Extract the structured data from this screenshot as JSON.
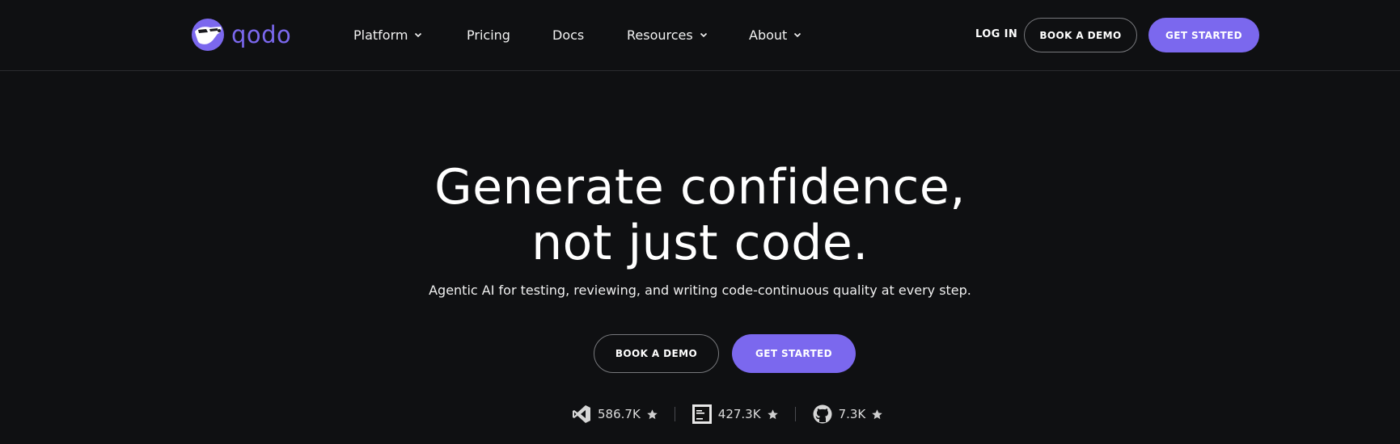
{
  "brand": {
    "name": "qodo",
    "logo_icon": "qodo-mascot-icon",
    "accent_color": "#7b68ee",
    "background_color": "#0f1012"
  },
  "nav": {
    "items": [
      {
        "label": "Platform",
        "has_dropdown": true
      },
      {
        "label": "Pricing",
        "has_dropdown": false
      },
      {
        "label": "Docs",
        "has_dropdown": false
      },
      {
        "label": "Resources",
        "has_dropdown": true
      },
      {
        "label": "About",
        "has_dropdown": true
      }
    ],
    "login_label": "LOG IN",
    "book_demo_label": "BOOK A DEMO",
    "get_started_label": "GET STARTED"
  },
  "hero": {
    "headline_line1": "Generate confidence,",
    "headline_line2": "not just code.",
    "subheadline": "Agentic AI for testing, reviewing, and writing code-continuous quality at every step.",
    "book_demo_label": "BOOK A DEMO",
    "get_started_label": "GET STARTED"
  },
  "stats": [
    {
      "platform_icon": "vscode-icon",
      "count": "586.7K",
      "rating_icon": "star-icon"
    },
    {
      "platform_icon": "jetbrains-icon",
      "count": "427.3K",
      "rating_icon": "star-icon"
    },
    {
      "platform_icon": "github-icon",
      "count": "7.3K",
      "rating_icon": "star-icon"
    }
  ]
}
